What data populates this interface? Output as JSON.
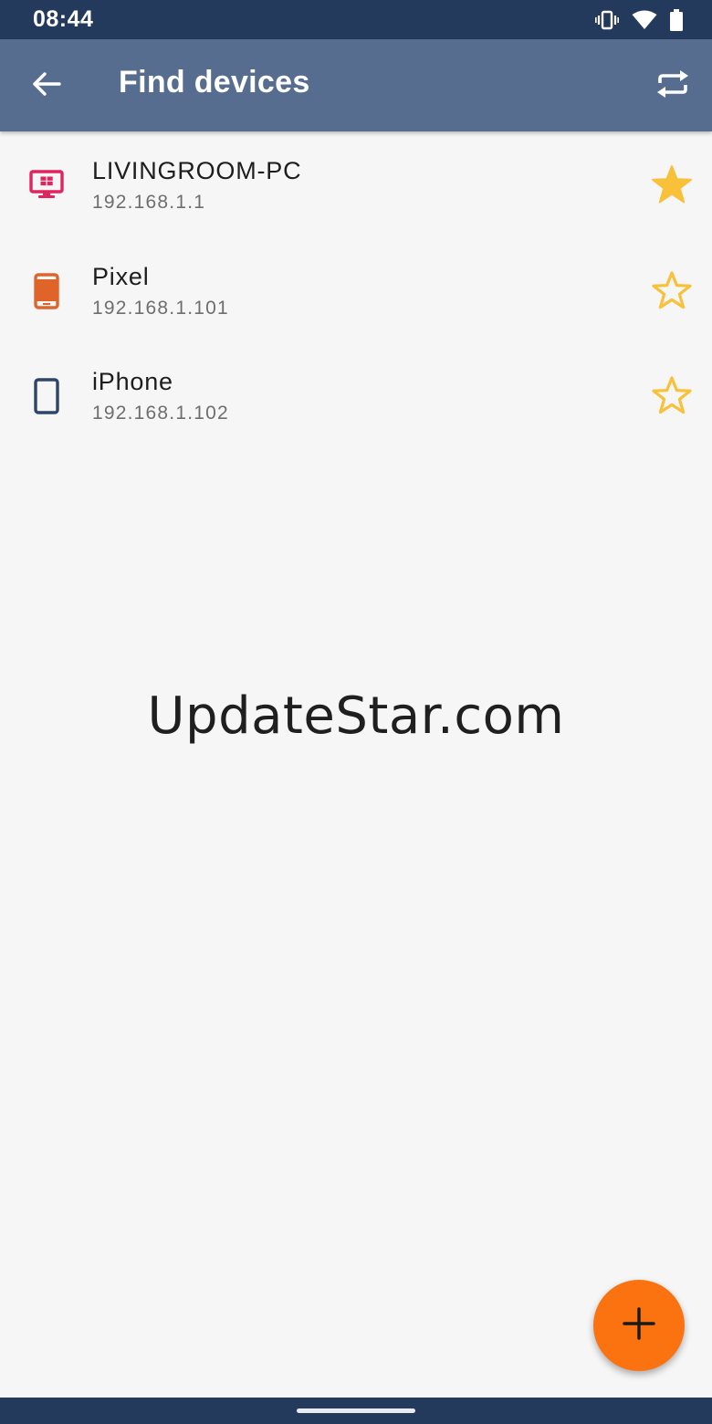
{
  "status_bar": {
    "time": "08:44",
    "icons": [
      "vibrate-icon",
      "wifi-icon",
      "battery-icon"
    ]
  },
  "app_bar": {
    "title": "Find devices",
    "back_icon": "arrow-left-icon",
    "refresh_icon": "refresh-icon"
  },
  "devices": [
    {
      "name": "LIVINGROOM-PC",
      "ip": "192.168.1.1",
      "icon": "windows-monitor-icon",
      "icon_color": "#e0245e",
      "favorite": true
    },
    {
      "name": "Pixel",
      "ip": "192.168.1.101",
      "icon": "phone-icon",
      "icon_color": "#e0642a",
      "favorite": false
    },
    {
      "name": "iPhone",
      "ip": "192.168.1.102",
      "icon": "phone-icon",
      "icon_color": "#2f4568",
      "favorite": false
    }
  ],
  "watermark": "UpdateStar.com",
  "fab": {
    "icon": "plus-icon",
    "color": "#fb7310"
  },
  "colors": {
    "status_bar": "#233a5d",
    "app_bar": "#566d90",
    "star": "#f9c13a",
    "background": "#f6f6f6"
  }
}
